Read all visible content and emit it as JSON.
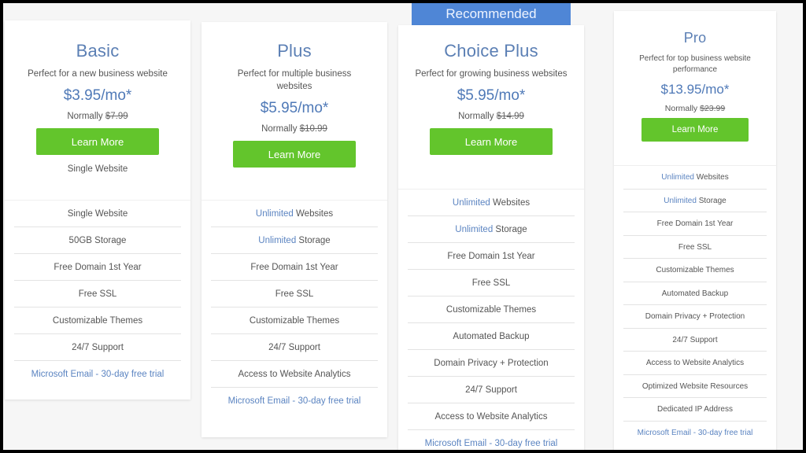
{
  "recommended_badge": "Recommended",
  "plans": [
    {
      "name": "Basic",
      "tagline": "Perfect for a new business website",
      "price": "$3.95/mo*",
      "normally_label": "Normally",
      "normally_price": "$7.99",
      "button": "Learn More",
      "top_feature": "Single Website",
      "features": [
        {
          "hl": "",
          "text": "Single Website"
        },
        {
          "hl": "",
          "text": "50GB Storage"
        },
        {
          "hl": "",
          "text": "Free Domain 1st Year"
        },
        {
          "hl": "",
          "text": "Free SSL"
        },
        {
          "hl": "",
          "text": "Customizable Themes"
        },
        {
          "hl": "",
          "text": "24/7 Support"
        },
        {
          "hl": "",
          "text": "Microsoft Email - 30-day free trial",
          "email": true
        }
      ]
    },
    {
      "name": "Plus",
      "tagline": "Perfect for multiple business websites",
      "price": "$5.95/mo*",
      "normally_label": "Normally",
      "normally_price": "$10.99",
      "button": "Learn More",
      "features": [
        {
          "hl": "Unlimited",
          "text": " Websites"
        },
        {
          "hl": "Unlimited",
          "text": " Storage"
        },
        {
          "hl": "",
          "text": "Free Domain 1st Year"
        },
        {
          "hl": "",
          "text": "Free SSL"
        },
        {
          "hl": "",
          "text": "Customizable Themes"
        },
        {
          "hl": "",
          "text": "24/7 Support"
        },
        {
          "hl": "",
          "text": "Access to Website Analytics"
        },
        {
          "hl": "",
          "text": "Microsoft Email - 30-day free trial",
          "email": true
        }
      ]
    },
    {
      "name": "Choice Plus",
      "tagline": "Perfect for growing business websites",
      "price": "$5.95/mo*",
      "normally_label": "Normally",
      "normally_price": "$14.99",
      "button": "Learn More",
      "recommended": true,
      "features": [
        {
          "hl": "Unlimited",
          "text": " Websites"
        },
        {
          "hl": "Unlimited",
          "text": " Storage"
        },
        {
          "hl": "",
          "text": "Free Domain 1st Year"
        },
        {
          "hl": "",
          "text": "Free SSL"
        },
        {
          "hl": "",
          "text": "Customizable Themes"
        },
        {
          "hl": "",
          "text": "Automated Backup"
        },
        {
          "hl": "",
          "text": "Domain Privacy + Protection"
        },
        {
          "hl": "",
          "text": "24/7 Support"
        },
        {
          "hl": "",
          "text": "Access to Website Analytics"
        },
        {
          "hl": "",
          "text": "Microsoft Email - 30-day free trial",
          "email": true
        }
      ]
    },
    {
      "name": "Pro",
      "tagline": "Perfect for top business website performance",
      "price": "$13.95/mo*",
      "normally_label": "Normally",
      "normally_price": "$23.99",
      "button": "Learn More",
      "features": [
        {
          "hl": "Unlimited",
          "text": " Websites"
        },
        {
          "hl": "Unlimited",
          "text": " Storage"
        },
        {
          "hl": "",
          "text": "Free Domain 1st Year"
        },
        {
          "hl": "",
          "text": "Free SSL"
        },
        {
          "hl": "",
          "text": "Customizable Themes"
        },
        {
          "hl": "",
          "text": "Automated Backup"
        },
        {
          "hl": "",
          "text": "Domain Privacy + Protection"
        },
        {
          "hl": "",
          "text": "24/7 Support"
        },
        {
          "hl": "",
          "text": "Access to Website Analytics"
        },
        {
          "hl": "",
          "text": "Optimized Website Resources"
        },
        {
          "hl": "",
          "text": "Dedicated IP Address"
        },
        {
          "hl": "",
          "text": "Microsoft Email - 30-day free trial",
          "email": true
        }
      ]
    }
  ],
  "colors": {
    "accent_blue": "#4f79b7",
    "button_green": "#63c52c",
    "badge_blue": "#4f86d6"
  }
}
